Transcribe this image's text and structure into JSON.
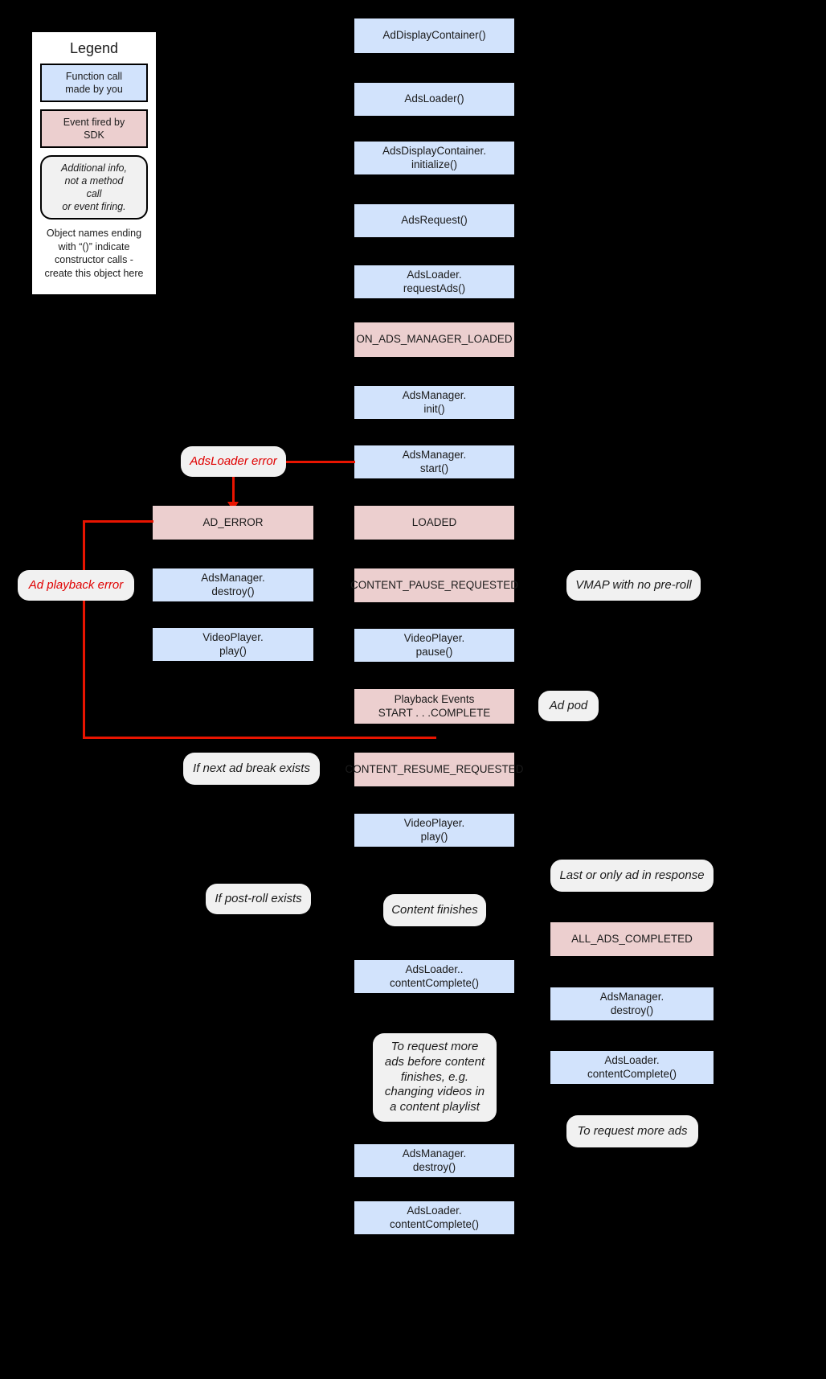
{
  "legend": {
    "title": "Legend",
    "call_sample": "Function call\nmade by you",
    "event_sample": "Event fired by\nSDK",
    "info_sample": "Additional info,\nnot a method\ncall\nor event firing.",
    "note": "Object names ending\nwith “()” indicate\nconstructor calls -\ncreate this object here"
  },
  "colors": {
    "background": "#000000",
    "function_call": "#d2e3fc",
    "sdk_event": "#eccfcf",
    "info": "#f1f1f1",
    "error_line": "#e81400",
    "error_text": "#e00000",
    "text": "#1b1b1b"
  },
  "nodes": {
    "ad_display_container": "AdDisplayContainer()",
    "ads_loader": "AdsLoader()",
    "ads_display_container_initialize": "AdsDisplayContainer.\ninitialize()",
    "ads_request": "AdsRequest()",
    "ads_loader_request_ads": "AdsLoader.\nrequestAds()",
    "on_ads_manager_loaded": "ON_ADS_MANAGER_LOADED",
    "ads_manager_init": "AdsManager.\ninit()",
    "ads_manager_start": "AdsManager.\nstart()",
    "ads_loader_error": "AdsLoader error",
    "ad_error": "AD_ERROR",
    "loaded": "LOADED",
    "ad_playback_error": "Ad playback error",
    "ads_manager_destroy_left": "AdsManager.\ndestroy()",
    "content_pause_requested": "CONTENT_PAUSE_REQUESTED",
    "vmap_no_preroll": "VMAP with no pre-roll",
    "video_player_play_left": "VideoPlayer.\nplay()",
    "video_player_pause": "VideoPlayer.\npause()",
    "playback_events": "Playback Events\nSTART . . .COMPLETE",
    "ad_pod": "Ad pod",
    "if_next_ad_break_exists": "If next ad break exists",
    "content_resume_requested": "CONTENT_RESUME_REQUESTED",
    "video_player_play_center": "VideoPlayer.\nplay()",
    "last_or_only_ad": "Last or only ad in response",
    "if_post_roll_exists": "If post-roll exists",
    "content_finishes": "Content finishes",
    "all_ads_completed": "ALL_ADS_COMPLETED",
    "ads_loader_content_complete_mid": "AdsLoader..\ncontentComplete()",
    "ads_manager_destroy_right": "AdsManager.\ndestroy()",
    "to_request_more_ads_before": "To request more\nads before content\nfinishes, e.g.\nchanging videos in\na content playlist",
    "ads_loader_content_complete_right": "AdsLoader.\ncontentComplete()",
    "to_request_more_ads": "To request more ads",
    "ads_manager_destroy_bottom": "AdsManager.\ndestroy()",
    "ads_loader_content_complete_bottom": "AdsLoader.\ncontentComplete()"
  }
}
